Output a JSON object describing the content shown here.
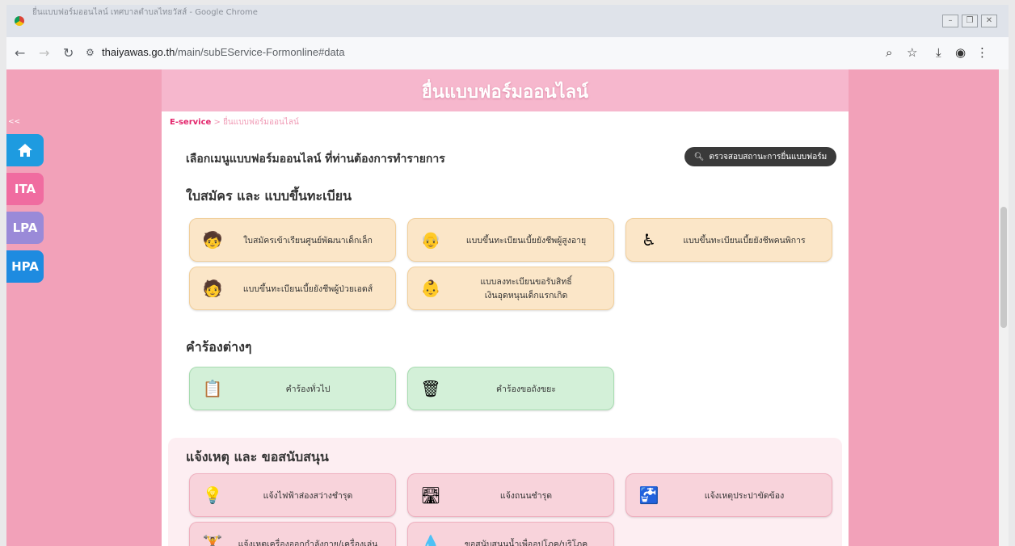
{
  "browser": {
    "tab_title": "ยื่นแบบฟอร์มออนไลน์ เทศบาลตำบลไทยวัสส์ - Google Chrome",
    "url_domain": "thaiyawas.go.th",
    "url_path": "/main/subEService-Formonline#data"
  },
  "page": {
    "heading": "ยื่นแบบฟอร์มออนไลน์",
    "breadcrumb": {
      "link": "E-service",
      "sep": " > ",
      "current": "ยื่นแบบฟอร์มออนไลน์"
    },
    "prompt": "เลือกเมนูแบบฟอร์มออนไลน์ ที่ท่านต้องการทำรายการ",
    "check_status_label": "ตรวจสอบสถานะการยื่นแบบฟอร์ม"
  },
  "sidebar": {
    "collapse": "<<",
    "ita": "ITA",
    "lpa": "LPA",
    "hpa": "HPA"
  },
  "sections": {
    "registration": {
      "title": "ใบสมัคร และ แบบขึ้นทะเบียน",
      "cards": [
        {
          "label": "ใบสมัครเข้าเรียนศูนย์พัฒนาเด็กเล็ก",
          "icon": "child-school-icon"
        },
        {
          "label": "แบบขึ้นทะเบียนเบี้ยยังชีพผู้สูงอายุ",
          "icon": "elderly-icon"
        },
        {
          "label": "แบบขึ้นทะเบียนเบี้ยยังชีพคนพิการ",
          "icon": "wheelchair-icon"
        },
        {
          "label": "แบบขึ้นทะเบียนเบี้ยยังชีพผู้ป่วยเอดส์",
          "icon": "patient-icon"
        },
        {
          "label_line1": "แบบลงทะเบียนขอรับสิทธิ์",
          "label_line2": "เงินอุดหนุนเด็กแรกเกิด",
          "icon": "baby-icon"
        }
      ]
    },
    "requests": {
      "title": "คำร้องต่างๆ",
      "cards": [
        {
          "label": "คำร้องทั่วไป",
          "icon": "document-icon"
        },
        {
          "label": "คำร้องขอถังขยะ",
          "icon": "trash-bin-icon"
        }
      ]
    },
    "reports": {
      "title": "แจ้งเหตุ และ ขอสนับสนุน",
      "cards": [
        {
          "label": "แจ้งไฟฟ้าส่องสว่างชำรุด",
          "icon": "lightbulb-icon"
        },
        {
          "label": "แจ้งถนนชำรุด",
          "icon": "road-icon"
        },
        {
          "label": "แจ้งเหตุประปาขัดข้อง",
          "icon": "water-tap-icon"
        },
        {
          "label": "แจ้งเหตุเครื่องออกกำลังกาย/เครื่องเล่น",
          "icon": "exercise-icon"
        },
        {
          "label": "ขอสนับสนุนน้ำเพื่ออุปโภค/บริโภค",
          "icon": "water-drop-icon"
        }
      ]
    }
  }
}
